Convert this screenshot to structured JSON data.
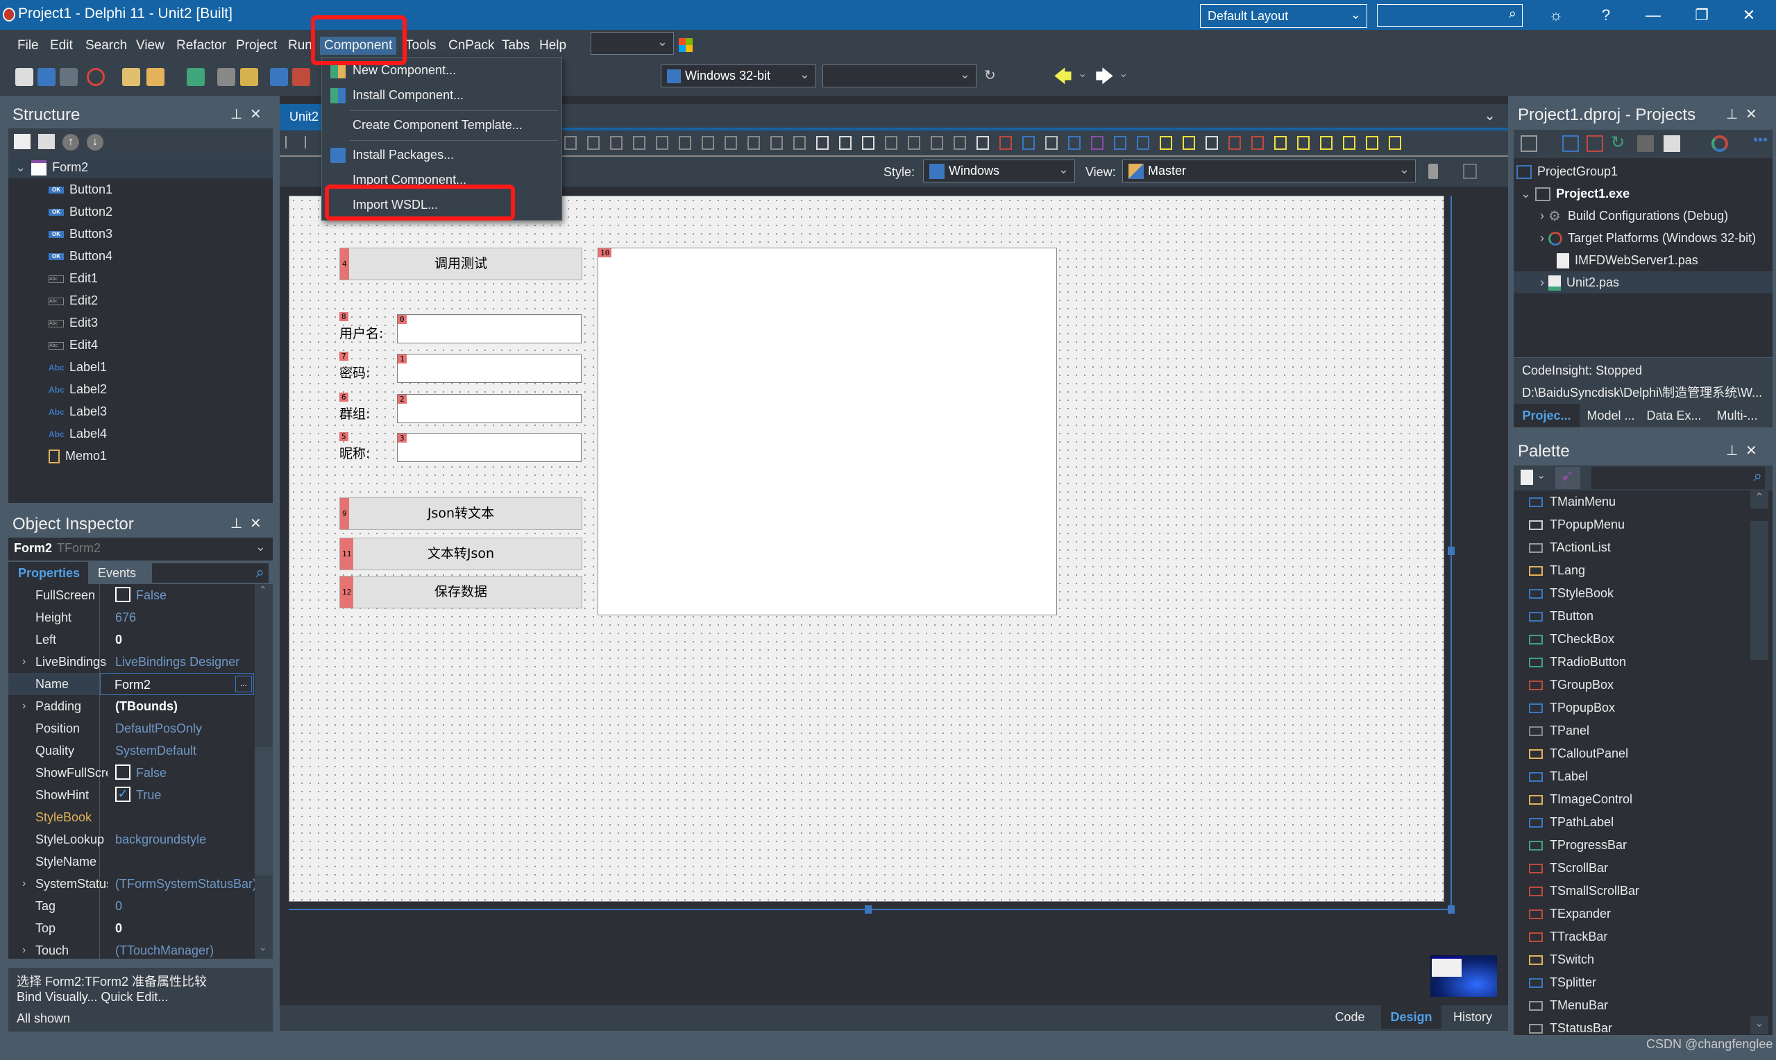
{
  "window": {
    "title": "Project1 - Delphi 11 - Unit2 [Built]",
    "layout_selector": "Default Layout",
    "search_placeholder": "",
    "controls": {
      "help": "?",
      "minimize": "—",
      "restore": "❐",
      "close": "✕"
    }
  },
  "menubar": {
    "items": [
      "File",
      "Edit",
      "Search",
      "View",
      "Refactor",
      "Project",
      "Run",
      "Component",
      "Tools",
      "CnPack",
      "Tabs",
      "Help"
    ],
    "active": "Component"
  },
  "toolbar": {
    "platform_combo": "Windows 32-bit",
    "config_combo": "",
    "device_combo": ""
  },
  "component_menu": {
    "items": [
      {
        "label": "New Component...",
        "icon": "new-component-icon"
      },
      {
        "label": "Install Component...",
        "icon": "install-component-icon"
      },
      {
        "label": "Create Component Template...",
        "icon": ""
      },
      {
        "label": "Install Packages...",
        "icon": "install-packages-icon"
      },
      {
        "label": "Import Component...",
        "icon": ""
      },
      {
        "label": "Import WSDL...",
        "icon": "",
        "highlighted": true
      }
    ]
  },
  "structure": {
    "title": "Structure",
    "root": "Form2",
    "children": [
      {
        "name": "Button1",
        "type": "button"
      },
      {
        "name": "Button2",
        "type": "button"
      },
      {
        "name": "Button3",
        "type": "button"
      },
      {
        "name": "Button4",
        "type": "button"
      },
      {
        "name": "Edit1",
        "type": "edit"
      },
      {
        "name": "Edit2",
        "type": "edit"
      },
      {
        "name": "Edit3",
        "type": "edit"
      },
      {
        "name": "Edit4",
        "type": "edit"
      },
      {
        "name": "Label1",
        "type": "label"
      },
      {
        "name": "Label2",
        "type": "label"
      },
      {
        "name": "Label3",
        "type": "label"
      },
      {
        "name": "Label4",
        "type": "label"
      },
      {
        "name": "Memo1",
        "type": "memo"
      }
    ]
  },
  "object_inspector": {
    "title": "Object Inspector",
    "selected_name": "Form2",
    "selected_type": "TForm2",
    "tabs": [
      "Properties",
      "Events"
    ],
    "active_tab": "Properties",
    "properties": [
      {
        "name": "FullScreen",
        "value": "False",
        "kind": "check",
        "checked": false
      },
      {
        "name": "Height",
        "value": "676",
        "kind": "default"
      },
      {
        "name": "Left",
        "value": "0",
        "kind": "bold"
      },
      {
        "name": "LiveBindings",
        "value": "LiveBindings Designer",
        "kind": "default",
        "expandable": true
      },
      {
        "name": "Name",
        "value": "Form2",
        "kind": "editing"
      },
      {
        "name": "Padding",
        "value": "(TBounds)",
        "kind": "bold",
        "expandable": true
      },
      {
        "name": "Position",
        "value": "DefaultPosOnly",
        "kind": "default"
      },
      {
        "name": "Quality",
        "value": "SystemDefault",
        "kind": "default"
      },
      {
        "name": "ShowFullScre",
        "value": "False",
        "kind": "check",
        "checked": false
      },
      {
        "name": "ShowHint",
        "value": "True",
        "kind": "check",
        "checked": true
      },
      {
        "name": "StyleBook",
        "value": "",
        "kind": "default",
        "highlight": true
      },
      {
        "name": "StyleLookup",
        "value": "backgroundstyle",
        "kind": "default"
      },
      {
        "name": "StyleName",
        "value": "",
        "kind": "default"
      },
      {
        "name": "SystemStatus",
        "value": "(TFormSystemStatusBar)",
        "kind": "default",
        "expandable": true
      },
      {
        "name": "Tag",
        "value": "0",
        "kind": "default"
      },
      {
        "name": "Top",
        "value": "0",
        "kind": "bold"
      },
      {
        "name": "Touch",
        "value": "(TTouchManager)",
        "kind": "default",
        "expandable": true
      }
    ],
    "footer_line1": "选择 Form2:TForm2 准备属性比较",
    "footer_line2": "Bind Visually...  Quick Edit...",
    "footer_line3": "All shown"
  },
  "editor": {
    "tab": "Unit2",
    "style_label": "Style:",
    "style_value": "Windows",
    "view_label": "View:",
    "view_value": "Master",
    "bottom_tabs": [
      "Code",
      "Design",
      "History"
    ],
    "active_bottom_tab": "Design"
  },
  "form": {
    "buttons": [
      {
        "label": "调用测试",
        "tab_order": "4"
      },
      {
        "label": "Json转文本",
        "tab_order": "9"
      },
      {
        "label": "文本转Json",
        "tab_order": "11"
      },
      {
        "label": "保存数据",
        "tab_order": "12"
      }
    ],
    "labels": [
      {
        "text": "用户名:",
        "tab_order": "8"
      },
      {
        "text": "密码:",
        "tab_order": "7"
      },
      {
        "text": "群组:",
        "tab_order": "6"
      },
      {
        "text": "昵称:",
        "tab_order": "5"
      }
    ],
    "edits": [
      {
        "value": "",
        "tab_order": "0"
      },
      {
        "value": "",
        "tab_order": "1"
      },
      {
        "value": "",
        "tab_order": "2"
      },
      {
        "value": "",
        "tab_order": "3"
      }
    ],
    "memo": {
      "value": "",
      "tab_order": "10"
    }
  },
  "projects": {
    "title": "Project1.dproj - Projects",
    "group": "ProjectGroup1",
    "project": "Project1.exe",
    "nodes": [
      {
        "label": "Build Configurations (Debug)",
        "expandable": true
      },
      {
        "label": "Target Platforms (Windows 32-bit)",
        "expandable": true
      },
      {
        "label": "IMFDWebServer1.pas",
        "expandable": false
      },
      {
        "label": "Unit2.pas",
        "expandable": true,
        "selected": true
      }
    ],
    "status1": "CodeInsight: Stopped",
    "status2": "D:\\BaiduSyncdisk\\Delphi\\制造管理系统\\W...",
    "tabs": [
      "Projec...",
      "Model ...",
      "Data Ex...",
      "Multi-..."
    ],
    "active_tab": "Projec..."
  },
  "palette": {
    "title": "Palette",
    "items": [
      "TMainMenu",
      "TPopupMenu",
      "TActionList",
      "TLang",
      "TStyleBook",
      "TButton",
      "TCheckBox",
      "TRadioButton",
      "TGroupBox",
      "TPopupBox",
      "TPanel",
      "TCalloutPanel",
      "TLabel",
      "TImageControl",
      "TPathLabel",
      "TProgressBar",
      "TScrollBar",
      "TSmallScrollBar",
      "TExpander",
      "TTrackBar",
      "TSwitch",
      "TSplitter",
      "TMenuBar",
      "TStatusBar"
    ]
  },
  "watermark": "CSDN @changfenglee",
  "colors": {
    "accent": "#1563a4",
    "highlight_red": "#ff1a1a",
    "tab_order_badge": "#e57373"
  }
}
